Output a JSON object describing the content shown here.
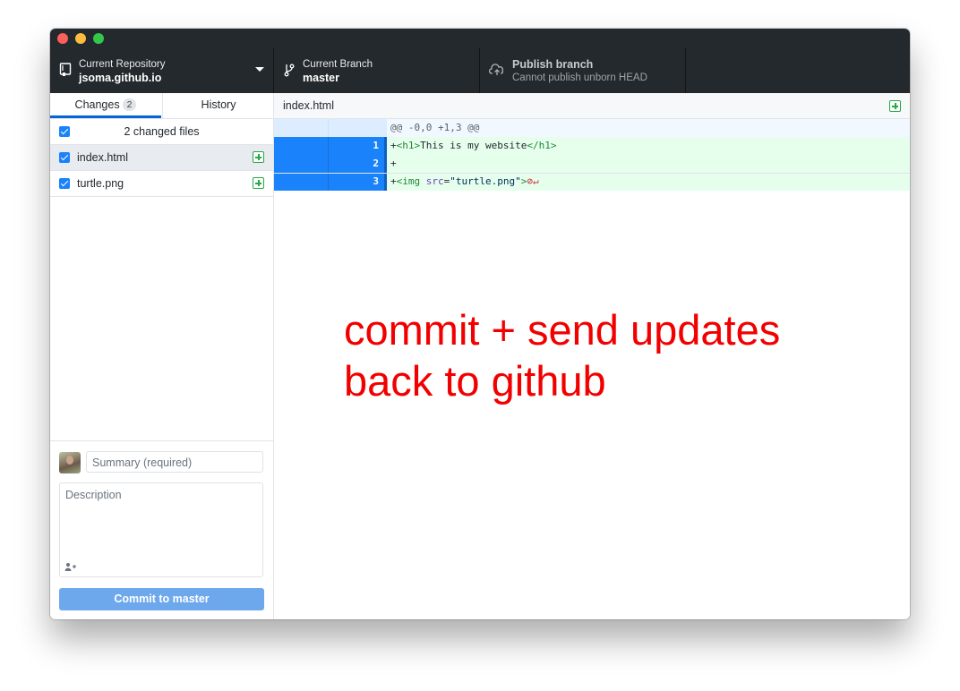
{
  "toolbar": {
    "repository": {
      "label": "Current Repository",
      "value": "jsoma.github.io"
    },
    "branch": {
      "label": "Current Branch",
      "value": "master"
    },
    "publish": {
      "label": "Publish branch",
      "value": "Cannot publish unborn HEAD"
    }
  },
  "sidebar": {
    "tabs": [
      {
        "label": "Changes",
        "badge": "2"
      },
      {
        "label": "History"
      }
    ],
    "changed_files_title": "2 changed files",
    "files": [
      {
        "name": "index.html",
        "status": "added",
        "checked": true,
        "selected": true
      },
      {
        "name": "turtle.png",
        "status": "added",
        "checked": true,
        "selected": false
      }
    ],
    "commit": {
      "summary_placeholder": "Summary (required)",
      "description_placeholder": "Description",
      "button_prefix": "Commit to ",
      "button_branch": "master"
    }
  },
  "diff": {
    "file": "index.html",
    "hunk": "@@ -0,0 +1,3 @@",
    "lines": [
      {
        "number": "1",
        "parts": [
          "+",
          "<h1>",
          "This is my website",
          "</h1>"
        ]
      },
      {
        "number": "2",
        "parts": [
          "+"
        ]
      },
      {
        "number": "3",
        "parts": [
          "+",
          "<img ",
          "src",
          "=",
          "\"turtle.png\"",
          ">"
        ],
        "no_newline_marker": "⊘↵"
      }
    ]
  },
  "annotation": {
    "line1": "commit + send updates",
    "line2": "back to github"
  },
  "colors": {
    "accent_blue": "#1a82fb",
    "added_green": "#28a745",
    "annotation_red": "#f20000",
    "toolbar_bg": "#24292e"
  }
}
